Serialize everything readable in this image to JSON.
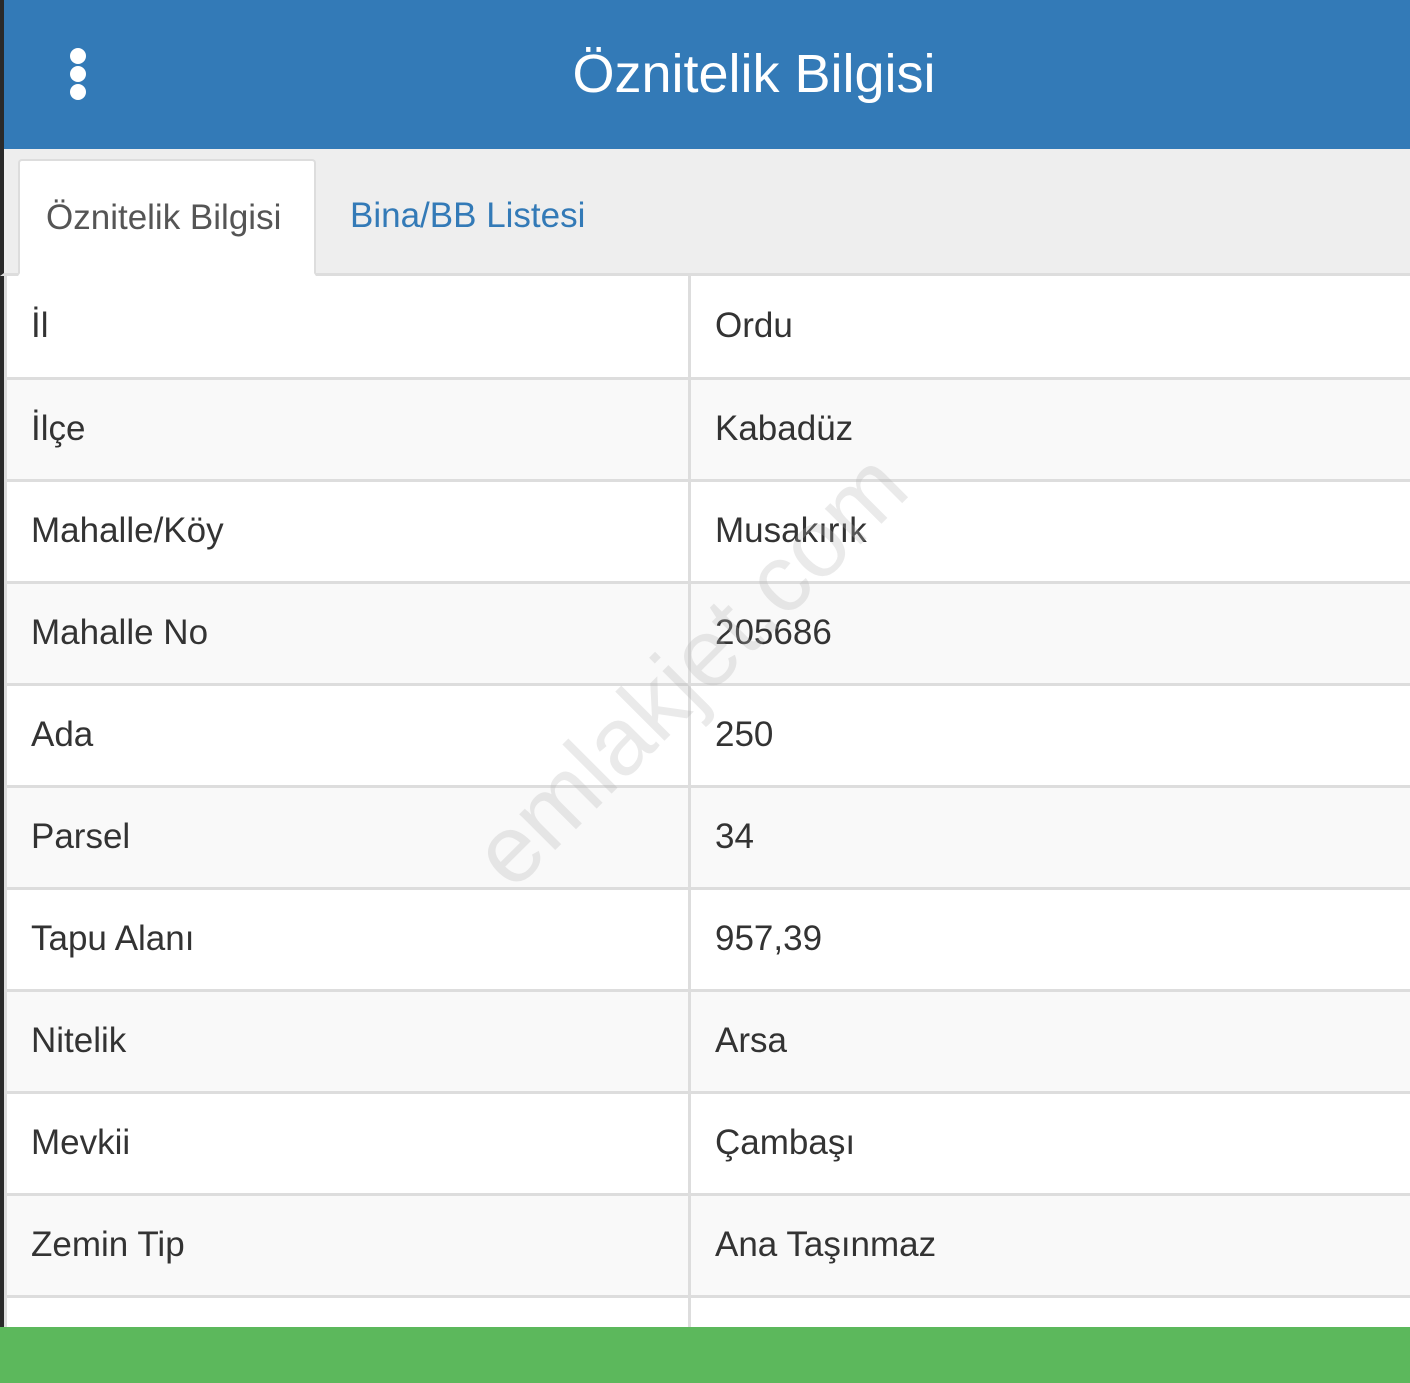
{
  "header": {
    "title": "Öznitelik Bilgisi",
    "menu_icon": "vertical-ellipsis-icon",
    "color": "#337ab7"
  },
  "tabs": [
    {
      "label": "Öznitelik Bilgisi",
      "active": true
    },
    {
      "label": "Bina/BB Listesi",
      "active": false
    }
  ],
  "attributes": [
    {
      "key": "İl",
      "value": "Ordu"
    },
    {
      "key": "İlçe",
      "value": "Kabadüz"
    },
    {
      "key": "Mahalle/Köy",
      "value": "Musakırık"
    },
    {
      "key": "Mahalle No",
      "value": "205686"
    },
    {
      "key": "Ada",
      "value": "250"
    },
    {
      "key": "Parsel",
      "value": "34"
    },
    {
      "key": "Tapu Alanı",
      "value": "957,39"
    },
    {
      "key": "Nitelik",
      "value": "Arsa"
    },
    {
      "key": "Mevkii",
      "value": "Çambaşı"
    },
    {
      "key": "Zemin Tip",
      "value": "Ana Taşınmaz"
    },
    {
      "key": "",
      "value": ""
    }
  ],
  "watermark": "emlakjet.com",
  "footer": {
    "color": "#5cb85c"
  }
}
